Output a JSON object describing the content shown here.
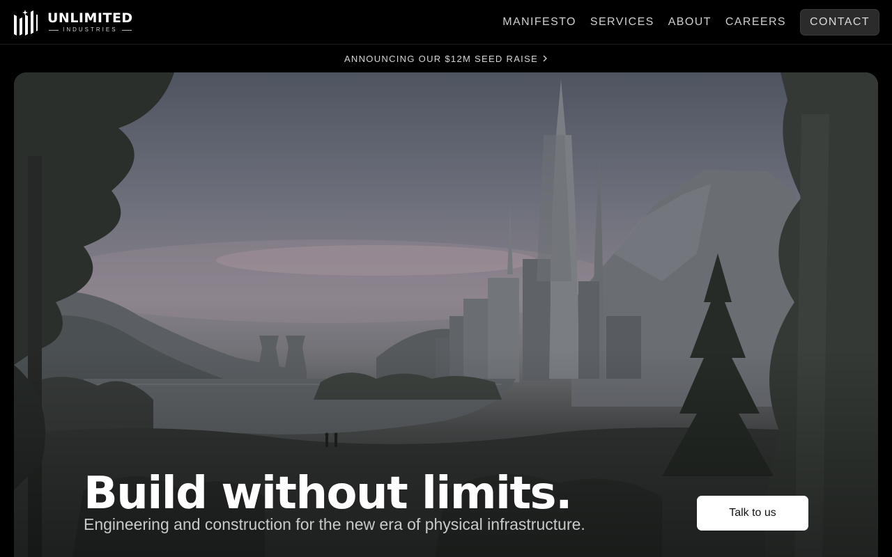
{
  "brand": {
    "name": "UNLIMITED",
    "subtitle": "INDUSTRIES"
  },
  "nav": {
    "links": [
      {
        "label": "MANIFESTO"
      },
      {
        "label": "SERVICES"
      },
      {
        "label": "ABOUT"
      },
      {
        "label": "CAREERS"
      }
    ],
    "contact_label": "CONTACT"
  },
  "announcement": {
    "text": "ANNOUNCING OUR $12M SEED RAISE",
    "icon": "chevron-right-icon"
  },
  "hero": {
    "title": "Build without limits.",
    "subtitle": "Engineering and construction for the new era of physical infrastructure.",
    "cta_label": "Talk to us"
  },
  "colors": {
    "background": "#000000",
    "nav_text": "#cfcfcf",
    "contact_button_bg": "#2b2b2b",
    "cta_bg": "#ffffff"
  }
}
